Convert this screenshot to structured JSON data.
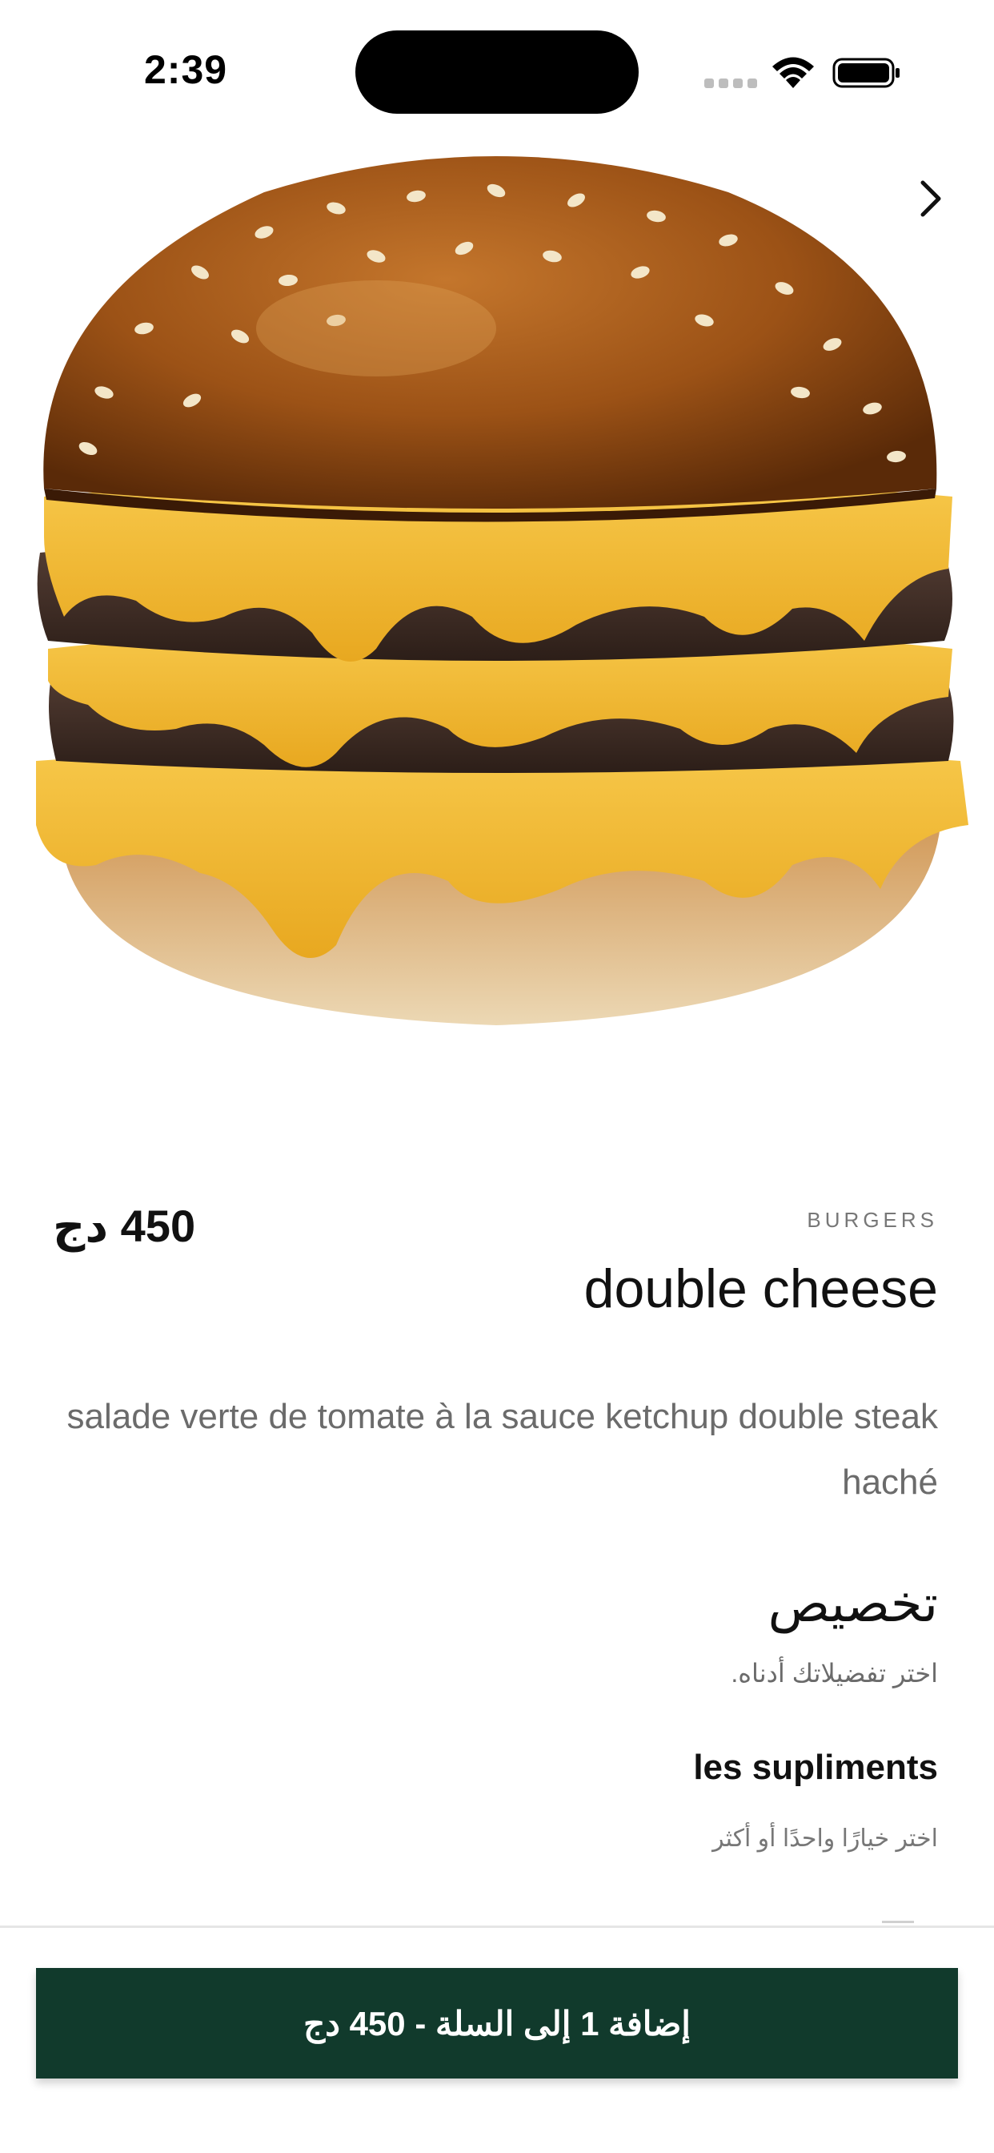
{
  "status_bar": {
    "time": "2:39",
    "icons": [
      "cellular-signal-icon",
      "wifi-icon",
      "battery-icon"
    ]
  },
  "hero": {
    "image": "burger-image",
    "next_icon": "chevron-right-icon"
  },
  "product": {
    "category": "BURGERS",
    "title": "double cheese",
    "price": "450 دج",
    "description": "salade verte de tomate à la sauce ketchup double steak haché"
  },
  "customize": {
    "title": "تخصيص",
    "subtitle": "اختر تفضيلاتك أدناه.",
    "groups": [
      {
        "title": "les supliments",
        "subtitle": "اختر خيارًا واحدًا أو أكثر"
      }
    ]
  },
  "cart": {
    "button_label": "إضافة 1 إلى السلة - 450 دج"
  },
  "colors": {
    "primary": "#113a2c",
    "text": "#111111",
    "muted": "#6b6b6b"
  }
}
